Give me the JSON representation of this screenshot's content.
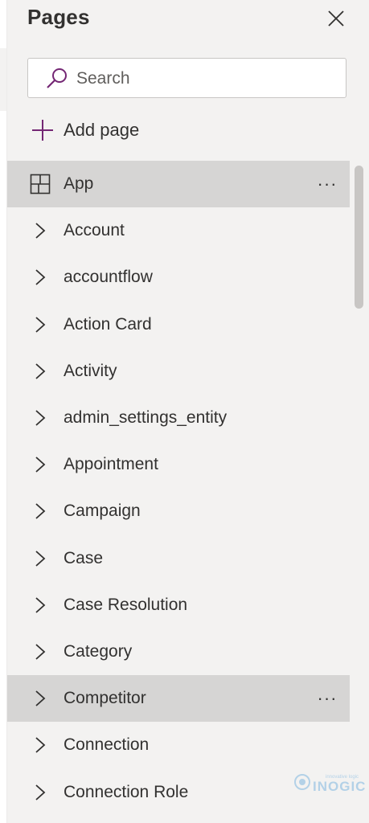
{
  "panel": {
    "title": "Pages"
  },
  "search": {
    "placeholder": "Search"
  },
  "add_page": {
    "label": "Add page"
  },
  "items": [
    {
      "label": "App",
      "icon": "layout-icon",
      "highlighted": true,
      "more": "···"
    },
    {
      "label": "Account",
      "icon": "chevron-right-icon"
    },
    {
      "label": "accountflow",
      "icon": "chevron-right-icon"
    },
    {
      "label": "Action Card",
      "icon": "chevron-right-icon"
    },
    {
      "label": "Activity",
      "icon": "chevron-right-icon"
    },
    {
      "label": "admin_settings_entity",
      "icon": "chevron-right-icon"
    },
    {
      "label": "Appointment",
      "icon": "chevron-right-icon"
    },
    {
      "label": "Campaign",
      "icon": "chevron-right-icon"
    },
    {
      "label": "Case",
      "icon": "chevron-right-icon"
    },
    {
      "label": "Case Resolution",
      "icon": "chevron-right-icon"
    },
    {
      "label": "Category",
      "icon": "chevron-right-icon"
    },
    {
      "label": "Competitor",
      "icon": "chevron-right-icon",
      "highlighted": true,
      "more": "···"
    },
    {
      "label": "Connection",
      "icon": "chevron-right-icon"
    },
    {
      "label": "Connection Role",
      "icon": "chevron-right-icon"
    }
  ],
  "watermark": {
    "small_text": "innovative logic",
    "brand_text": "INOGIC"
  },
  "colors": {
    "panel_background": "#f3f2f1",
    "highlight_row": "#d6d5d4",
    "accent_purple": "#742774",
    "text": "#323130",
    "scroll_thumb": "#c8c6c4"
  }
}
